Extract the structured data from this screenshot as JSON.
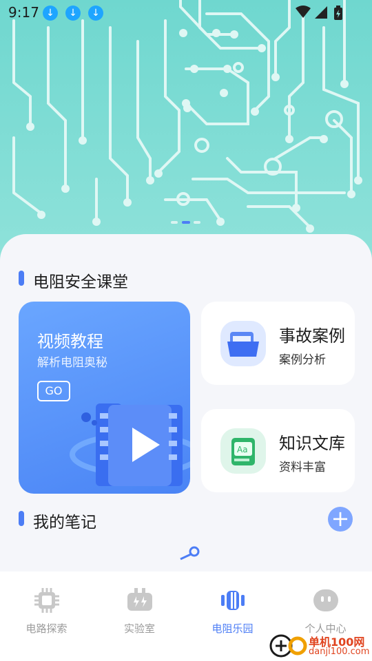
{
  "status_bar": {
    "time": "9:17",
    "download_icons": [
      "download-icon",
      "download-icon",
      "download-icon"
    ]
  },
  "section1": {
    "title": "电阻安全课堂"
  },
  "video_card": {
    "title": "视频教程",
    "subtitle": "解析电阻奥秘",
    "button": "GO"
  },
  "cards": [
    {
      "title": "事故案例",
      "subtitle": "案例分析",
      "icon": "folder-icon"
    },
    {
      "title": "知识文库",
      "subtitle": "资料丰富",
      "icon": "book-icon"
    }
  ],
  "section2": {
    "title": "我的笔记",
    "add": "+"
  },
  "tabs": [
    {
      "label": "电路探索",
      "icon": "chip-icon",
      "active": false
    },
    {
      "label": "实验室",
      "icon": "battery-icon",
      "active": false
    },
    {
      "label": "电阻乐园",
      "icon": "resistor-icon",
      "active": true
    },
    {
      "label": "个人中心",
      "icon": "face-icon",
      "active": false
    }
  ],
  "watermark": {
    "name": "单机100网",
    "url": "danji100.com"
  },
  "colors": {
    "accent": "#4c7df5",
    "hero": "#7edcd4"
  }
}
